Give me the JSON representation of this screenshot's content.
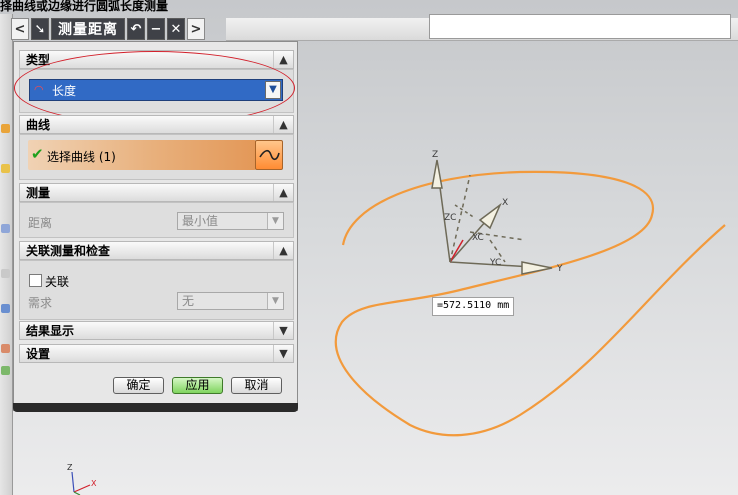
{
  "status_prompt": "择曲线或边缘进行圆弧长度测量",
  "toolbar": {
    "back": "<",
    "title": "测量距离",
    "undo": "↶",
    "minimize": "−",
    "close": "✕",
    "forward": ">"
  },
  "dialog": {
    "sections": {
      "type": "类型",
      "curve": "曲线",
      "measure": "测量",
      "associative": "关联测量和检查",
      "results": "结果显示",
      "settings": "设置"
    },
    "type_value": "长度",
    "select_curve": "选择曲线 (1)",
    "distance_label": "距离",
    "distance_value": "最小值",
    "associative_checkbox": "关联",
    "associative_checked": false,
    "requirement_label": "需求",
    "requirement_value": "无",
    "buttons": {
      "ok": "确定",
      "apply": "应用",
      "cancel": "取消"
    }
  },
  "measurement_readout": "=572.5110 mm",
  "axis_labels": {
    "z": "Z",
    "x": "X",
    "y": "Y",
    "zc": "ZC",
    "xc": "XC",
    "yc": "YC"
  },
  "mini_triad": {
    "z": "Z",
    "x": "X"
  },
  "colors": {
    "curve": "#f29a3c",
    "selection_highlight": "#316ac5",
    "annotation_circle": "#d2202b",
    "axis": "#6e6a58"
  }
}
